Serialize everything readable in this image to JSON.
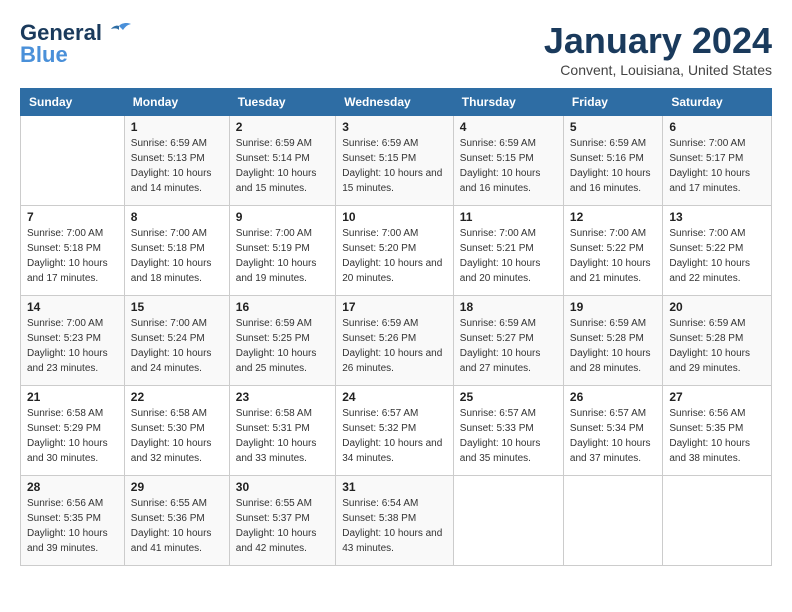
{
  "logo": {
    "line1": "General",
    "line2": "Blue"
  },
  "title": "January 2024",
  "subtitle": "Convent, Louisiana, United States",
  "days_header": [
    "Sunday",
    "Monday",
    "Tuesday",
    "Wednesday",
    "Thursday",
    "Friday",
    "Saturday"
  ],
  "weeks": [
    [
      {
        "day": "",
        "sunrise": "",
        "sunset": "",
        "daylight": ""
      },
      {
        "day": "1",
        "sunrise": "Sunrise: 6:59 AM",
        "sunset": "Sunset: 5:13 PM",
        "daylight": "Daylight: 10 hours and 14 minutes."
      },
      {
        "day": "2",
        "sunrise": "Sunrise: 6:59 AM",
        "sunset": "Sunset: 5:14 PM",
        "daylight": "Daylight: 10 hours and 15 minutes."
      },
      {
        "day": "3",
        "sunrise": "Sunrise: 6:59 AM",
        "sunset": "Sunset: 5:15 PM",
        "daylight": "Daylight: 10 hours and 15 minutes."
      },
      {
        "day": "4",
        "sunrise": "Sunrise: 6:59 AM",
        "sunset": "Sunset: 5:15 PM",
        "daylight": "Daylight: 10 hours and 16 minutes."
      },
      {
        "day": "5",
        "sunrise": "Sunrise: 6:59 AM",
        "sunset": "Sunset: 5:16 PM",
        "daylight": "Daylight: 10 hours and 16 minutes."
      },
      {
        "day": "6",
        "sunrise": "Sunrise: 7:00 AM",
        "sunset": "Sunset: 5:17 PM",
        "daylight": "Daylight: 10 hours and 17 minutes."
      }
    ],
    [
      {
        "day": "7",
        "sunrise": "Sunrise: 7:00 AM",
        "sunset": "Sunset: 5:18 PM",
        "daylight": "Daylight: 10 hours and 17 minutes."
      },
      {
        "day": "8",
        "sunrise": "Sunrise: 7:00 AM",
        "sunset": "Sunset: 5:18 PM",
        "daylight": "Daylight: 10 hours and 18 minutes."
      },
      {
        "day": "9",
        "sunrise": "Sunrise: 7:00 AM",
        "sunset": "Sunset: 5:19 PM",
        "daylight": "Daylight: 10 hours and 19 minutes."
      },
      {
        "day": "10",
        "sunrise": "Sunrise: 7:00 AM",
        "sunset": "Sunset: 5:20 PM",
        "daylight": "Daylight: 10 hours and 20 minutes."
      },
      {
        "day": "11",
        "sunrise": "Sunrise: 7:00 AM",
        "sunset": "Sunset: 5:21 PM",
        "daylight": "Daylight: 10 hours and 20 minutes."
      },
      {
        "day": "12",
        "sunrise": "Sunrise: 7:00 AM",
        "sunset": "Sunset: 5:22 PM",
        "daylight": "Daylight: 10 hours and 21 minutes."
      },
      {
        "day": "13",
        "sunrise": "Sunrise: 7:00 AM",
        "sunset": "Sunset: 5:22 PM",
        "daylight": "Daylight: 10 hours and 22 minutes."
      }
    ],
    [
      {
        "day": "14",
        "sunrise": "Sunrise: 7:00 AM",
        "sunset": "Sunset: 5:23 PM",
        "daylight": "Daylight: 10 hours and 23 minutes."
      },
      {
        "day": "15",
        "sunrise": "Sunrise: 7:00 AM",
        "sunset": "Sunset: 5:24 PM",
        "daylight": "Daylight: 10 hours and 24 minutes."
      },
      {
        "day": "16",
        "sunrise": "Sunrise: 6:59 AM",
        "sunset": "Sunset: 5:25 PM",
        "daylight": "Daylight: 10 hours and 25 minutes."
      },
      {
        "day": "17",
        "sunrise": "Sunrise: 6:59 AM",
        "sunset": "Sunset: 5:26 PM",
        "daylight": "Daylight: 10 hours and 26 minutes."
      },
      {
        "day": "18",
        "sunrise": "Sunrise: 6:59 AM",
        "sunset": "Sunset: 5:27 PM",
        "daylight": "Daylight: 10 hours and 27 minutes."
      },
      {
        "day": "19",
        "sunrise": "Sunrise: 6:59 AM",
        "sunset": "Sunset: 5:28 PM",
        "daylight": "Daylight: 10 hours and 28 minutes."
      },
      {
        "day": "20",
        "sunrise": "Sunrise: 6:59 AM",
        "sunset": "Sunset: 5:28 PM",
        "daylight": "Daylight: 10 hours and 29 minutes."
      }
    ],
    [
      {
        "day": "21",
        "sunrise": "Sunrise: 6:58 AM",
        "sunset": "Sunset: 5:29 PM",
        "daylight": "Daylight: 10 hours and 30 minutes."
      },
      {
        "day": "22",
        "sunrise": "Sunrise: 6:58 AM",
        "sunset": "Sunset: 5:30 PM",
        "daylight": "Daylight: 10 hours and 32 minutes."
      },
      {
        "day": "23",
        "sunrise": "Sunrise: 6:58 AM",
        "sunset": "Sunset: 5:31 PM",
        "daylight": "Daylight: 10 hours and 33 minutes."
      },
      {
        "day": "24",
        "sunrise": "Sunrise: 6:57 AM",
        "sunset": "Sunset: 5:32 PM",
        "daylight": "Daylight: 10 hours and 34 minutes."
      },
      {
        "day": "25",
        "sunrise": "Sunrise: 6:57 AM",
        "sunset": "Sunset: 5:33 PM",
        "daylight": "Daylight: 10 hours and 35 minutes."
      },
      {
        "day": "26",
        "sunrise": "Sunrise: 6:57 AM",
        "sunset": "Sunset: 5:34 PM",
        "daylight": "Daylight: 10 hours and 37 minutes."
      },
      {
        "day": "27",
        "sunrise": "Sunrise: 6:56 AM",
        "sunset": "Sunset: 5:35 PM",
        "daylight": "Daylight: 10 hours and 38 minutes."
      }
    ],
    [
      {
        "day": "28",
        "sunrise": "Sunrise: 6:56 AM",
        "sunset": "Sunset: 5:35 PM",
        "daylight": "Daylight: 10 hours and 39 minutes."
      },
      {
        "day": "29",
        "sunrise": "Sunrise: 6:55 AM",
        "sunset": "Sunset: 5:36 PM",
        "daylight": "Daylight: 10 hours and 41 minutes."
      },
      {
        "day": "30",
        "sunrise": "Sunrise: 6:55 AM",
        "sunset": "Sunset: 5:37 PM",
        "daylight": "Daylight: 10 hours and 42 minutes."
      },
      {
        "day": "31",
        "sunrise": "Sunrise: 6:54 AM",
        "sunset": "Sunset: 5:38 PM",
        "daylight": "Daylight: 10 hours and 43 minutes."
      },
      {
        "day": "",
        "sunrise": "",
        "sunset": "",
        "daylight": ""
      },
      {
        "day": "",
        "sunrise": "",
        "sunset": "",
        "daylight": ""
      },
      {
        "day": "",
        "sunrise": "",
        "sunset": "",
        "daylight": ""
      }
    ]
  ]
}
